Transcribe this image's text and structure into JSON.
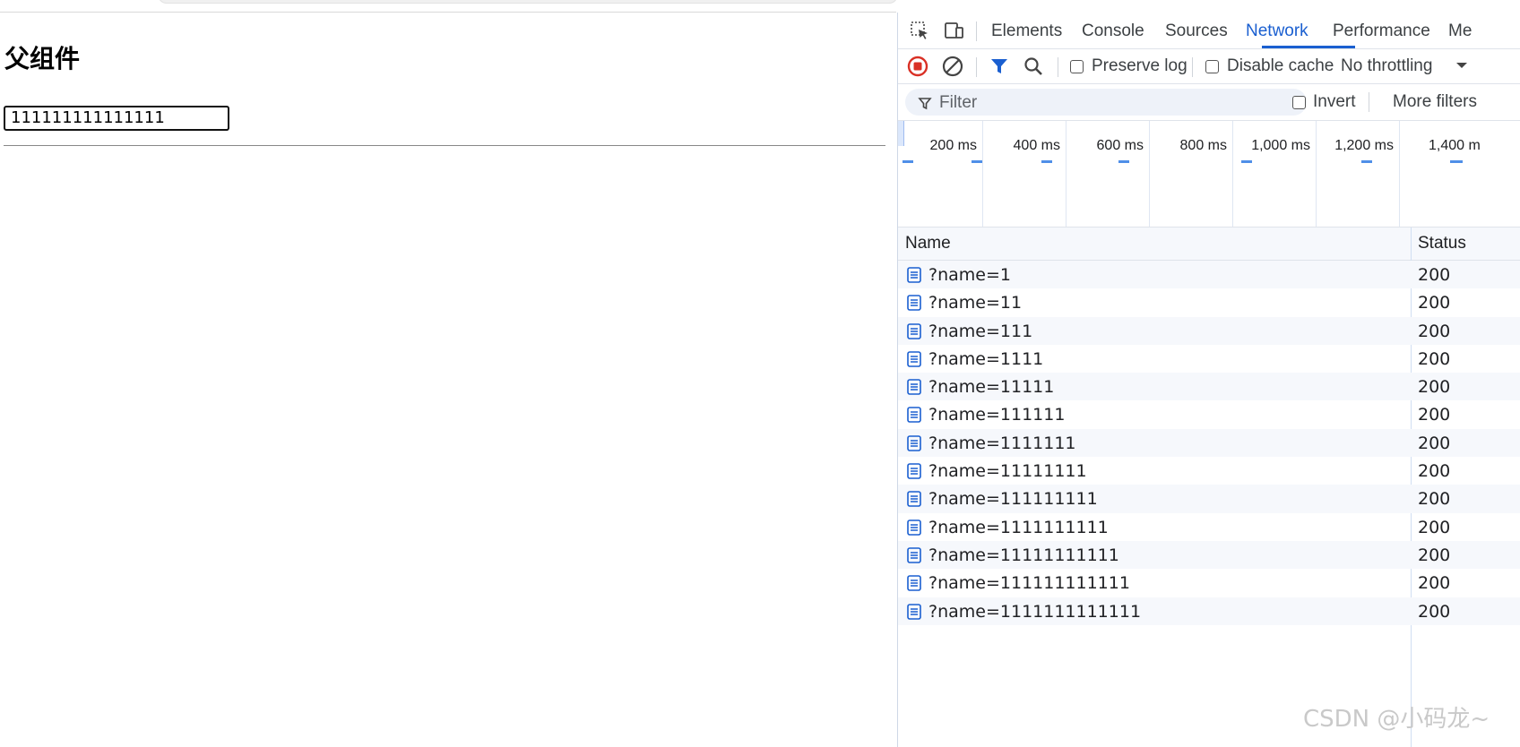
{
  "page": {
    "heading": "父组件",
    "input_value": "111111111111111"
  },
  "devtools": {
    "tabs": [
      {
        "label": "Elements",
        "active": false
      },
      {
        "label": "Console",
        "active": false
      },
      {
        "label": "Sources",
        "active": false
      },
      {
        "label": "Network",
        "active": true
      },
      {
        "label": "Performance",
        "active": false
      },
      {
        "label": "Me",
        "active": false
      }
    ],
    "toolbar": {
      "preserve_log_label": "Preserve log",
      "disable_cache_label": "Disable cache",
      "throttling_value": "No throttling"
    },
    "filter": {
      "placeholder": "Filter",
      "invert_label": "Invert",
      "more_filters_label": "More filters"
    },
    "timeline": {
      "ticks": [
        "200 ms",
        "400 ms",
        "600 ms",
        "800 ms",
        "1,000 ms",
        "1,200 ms",
        "1,400 m"
      ]
    },
    "table": {
      "columns": [
        "Name",
        "Status"
      ],
      "rows": [
        {
          "name": "?name=1",
          "status": "200"
        },
        {
          "name": "?name=11",
          "status": "200"
        },
        {
          "name": "?name=111",
          "status": "200"
        },
        {
          "name": "?name=1111",
          "status": "200"
        },
        {
          "name": "?name=11111",
          "status": "200"
        },
        {
          "name": "?name=111111",
          "status": "200"
        },
        {
          "name": "?name=1111111",
          "status": "200"
        },
        {
          "name": "?name=11111111",
          "status": "200"
        },
        {
          "name": "?name=111111111",
          "status": "200"
        },
        {
          "name": "?name=1111111111",
          "status": "200"
        },
        {
          "name": "?name=11111111111",
          "status": "200"
        },
        {
          "name": "?name=111111111111",
          "status": "200"
        },
        {
          "name": "?name=1111111111111",
          "status": "200"
        }
      ]
    },
    "accent_color": "#1a5fd0",
    "record_color": "#d93025"
  },
  "watermark": "CSDN @小码龙~"
}
